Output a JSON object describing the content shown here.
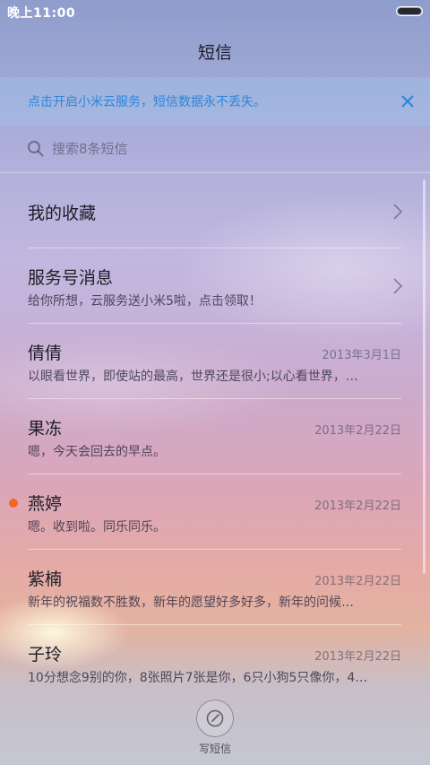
{
  "status_bar": {
    "time": "晚上11:00"
  },
  "header": {
    "title": "短信"
  },
  "banner": {
    "text": "点击开启小米云服务，短信数据永不丢失。",
    "close_icon": "close-icon"
  },
  "search": {
    "placeholder": "搜索8条短信",
    "icon": "search-icon"
  },
  "items": [
    {
      "title": "我的收藏",
      "snippet": "",
      "date": "",
      "unread": false,
      "chevron": true
    },
    {
      "title": "服务号消息",
      "snippet": "给你所想，云服务送小米5啦，点击领取！",
      "date": "",
      "unread": false,
      "chevron": true
    },
    {
      "title": "倩倩",
      "snippet": "以眼看世界，即使站的最高，世界还是很小;以心看世界，…",
      "date": "2013年3月1日",
      "unread": false,
      "chevron": false
    },
    {
      "title": "果冻",
      "snippet": "嗯，今天会回去的早点。",
      "date": "2013年2月22日",
      "unread": false,
      "chevron": false
    },
    {
      "title": "燕婷",
      "snippet": "嗯。收到啦。同乐同乐。",
      "date": "2013年2月22日",
      "unread": true,
      "chevron": false
    },
    {
      "title": "紫楠",
      "snippet": "新年的祝福数不胜数，新年的愿望好多好多，新年的问候…",
      "date": "2013年2月22日",
      "unread": false,
      "chevron": false
    },
    {
      "title": "子玲",
      "snippet": "10分想念9别的你，8张照片7张是你，6只小狗5只像你，4…",
      "date": "2013年2月22日",
      "unread": false,
      "chevron": false
    }
  ],
  "compose": {
    "label": "写短信",
    "icon": "compose-icon"
  },
  "colors": {
    "accent": "#2b86d8",
    "unread": "#f26522"
  }
}
